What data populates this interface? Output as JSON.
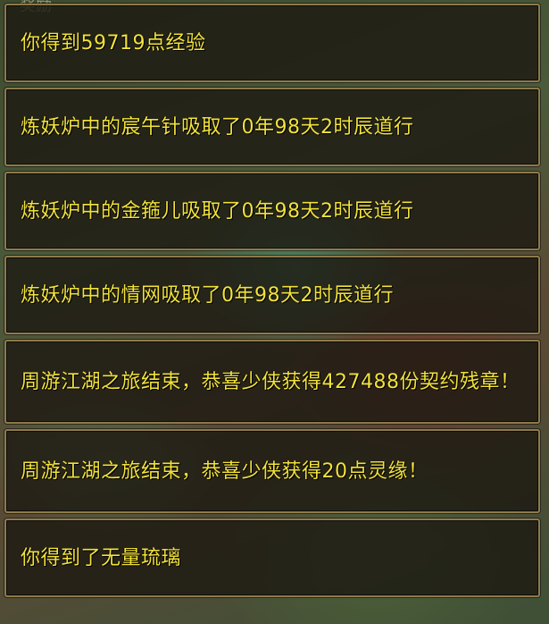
{
  "background": {
    "partial_label": "奖励"
  },
  "messages": [
    {
      "text": "你得到59719点经验"
    },
    {
      "text": "炼妖炉中的宸午针吸取了0年98天2时辰道行"
    },
    {
      "text": "炼妖炉中的金箍儿吸取了0年98天2时辰道行"
    },
    {
      "text": "炼妖炉中的情网吸取了0年98天2时辰道行"
    },
    {
      "text": "周游江湖之旅结束，恭喜少侠获得427488份契约残章！"
    },
    {
      "text": "周游江湖之旅结束，恭喜少侠获得20点灵缘！"
    },
    {
      "text": "你得到了无量琉璃"
    }
  ],
  "colors": {
    "message_text": "#f2e23c",
    "panel_border": "#8e7a4c"
  }
}
